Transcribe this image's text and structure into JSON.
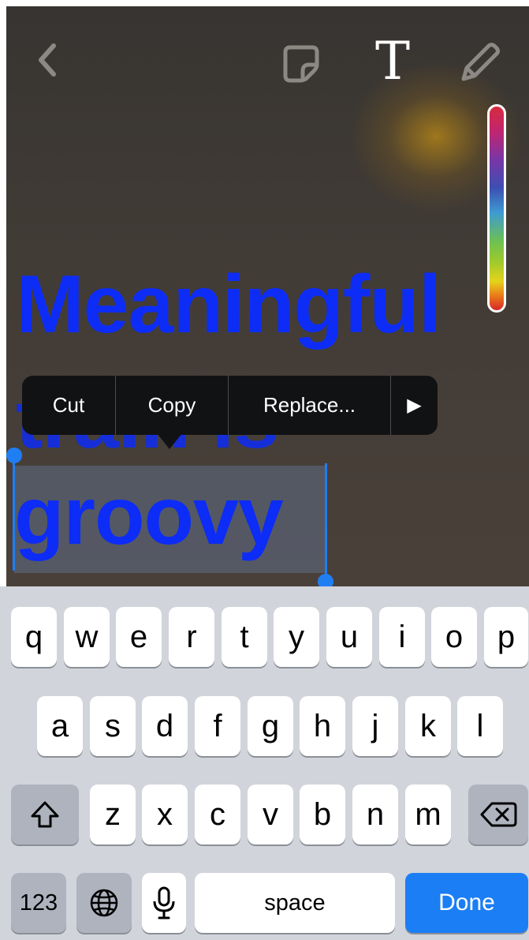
{
  "toolbar": {
    "back_icon": "chevron-left-icon",
    "sticker_icon": "sticker-icon",
    "text_tool_label": "T",
    "pencil_icon": "pencil-icon"
  },
  "color_slider": {
    "colors": [
      "#d62b3c",
      "#7a36a6",
      "#3d4fb3",
      "#3d9ad2",
      "#6cc053",
      "#e5d31b",
      "#e97a18"
    ]
  },
  "caption": {
    "line1": "Meaningful",
    "line2": "train is",
    "line3_selected": "groovy",
    "color": "#0d2cf5"
  },
  "edit_menu": {
    "cut": "Cut",
    "copy": "Copy",
    "replace": "Replace...",
    "more": "▶"
  },
  "keyboard": {
    "row1": [
      "q",
      "w",
      "e",
      "r",
      "t",
      "y",
      "u",
      "i",
      "o",
      "p"
    ],
    "row2": [
      "a",
      "s",
      "d",
      "f",
      "g",
      "h",
      "j",
      "k",
      "l"
    ],
    "row3": [
      "z",
      "x",
      "c",
      "v",
      "b",
      "n",
      "m"
    ],
    "shift_icon": "shift-icon",
    "delete_icon": "delete-icon",
    "numbers_label": "123",
    "globe_icon": "globe-icon",
    "mic_icon": "microphone-icon",
    "space_label": "space",
    "done_label": "Done",
    "done_color": "#1b7ef4"
  }
}
